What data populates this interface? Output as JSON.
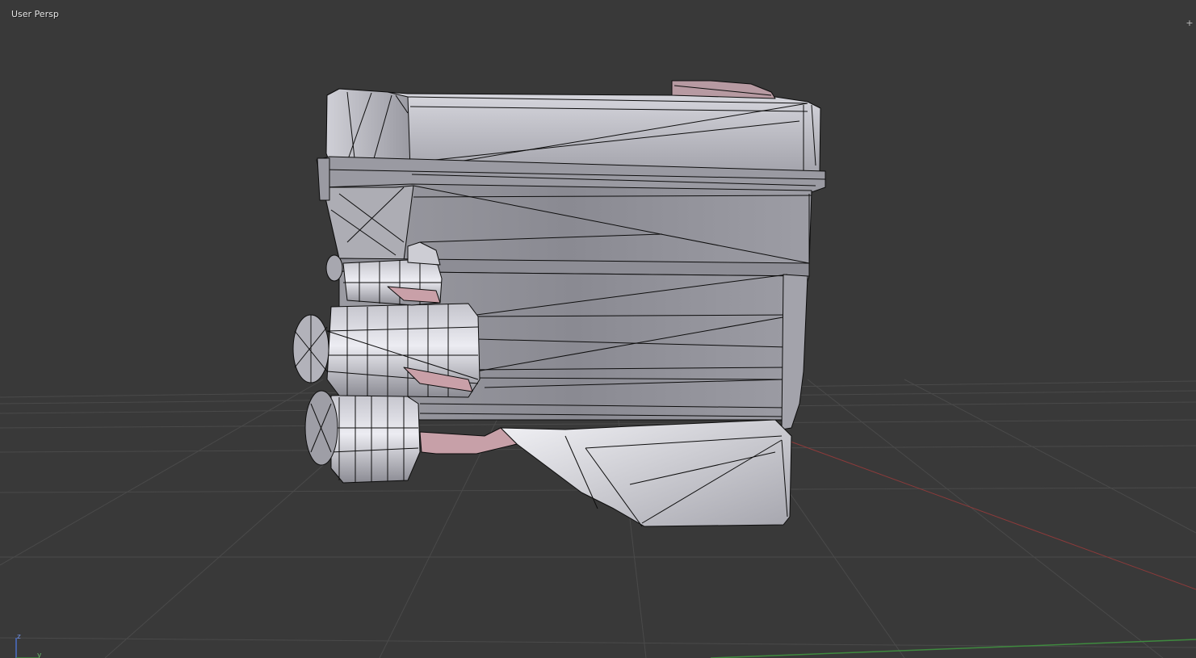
{
  "viewport": {
    "view_label": "User Persp",
    "corner_widget": "+"
  },
  "axis_widget": {
    "z_label": "z",
    "y_label": "y"
  },
  "colors": {
    "background": "#393939",
    "grid": "#4a4a4a",
    "x_axis": "#8c3a3a",
    "y_axis": "#3f8a3f",
    "wire": "#0d0d0d",
    "mesh_light": "#d8d8de",
    "mesh_mid": "#a5a5ac",
    "mesh_dark": "#7d7d84",
    "mesh_accent": "#c99aa2"
  },
  "icons": {
    "corner": "plus-icon"
  }
}
